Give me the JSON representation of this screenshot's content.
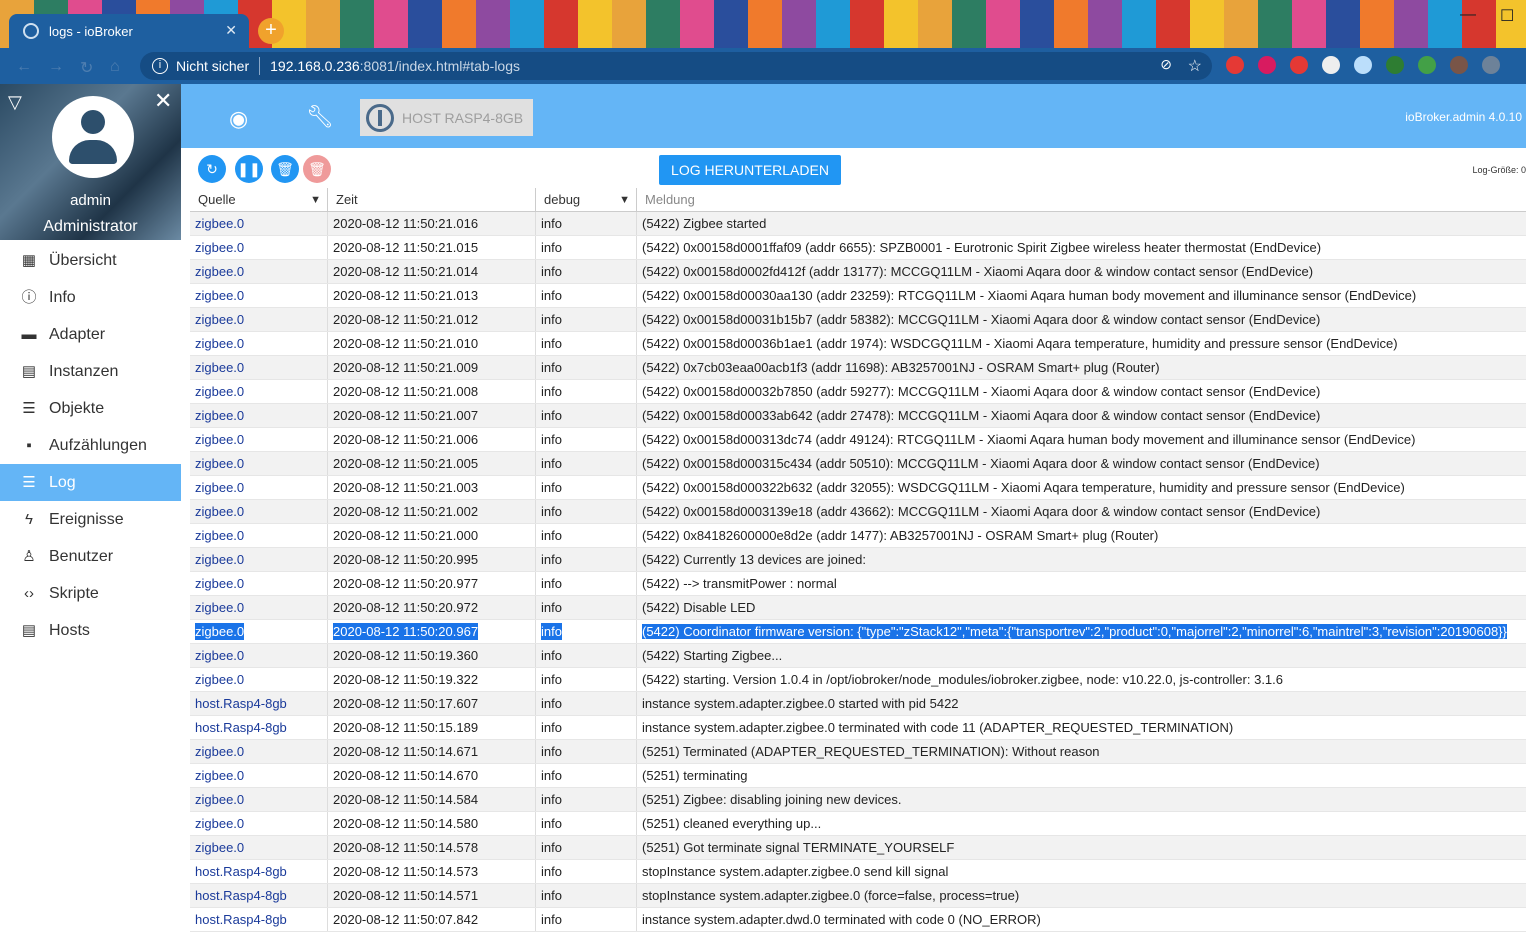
{
  "browser": {
    "tab_title": "logs - ioBroker",
    "new_tab": "+",
    "insecure_label": "Nicht sicher",
    "url_host": "192.168.0.236",
    "url_rest": ":8081/index.html#tab-logs"
  },
  "sidebar": {
    "user_name": "admin",
    "user_role": "Administrator",
    "items": [
      {
        "label": "Übersicht",
        "icon": "grid-icon"
      },
      {
        "label": "Info",
        "icon": "info-icon"
      },
      {
        "label": "Adapter",
        "icon": "store-icon"
      },
      {
        "label": "Instanzen",
        "icon": "instances-icon"
      },
      {
        "label": "Objekte",
        "icon": "list-icon"
      },
      {
        "label": "Aufzählungen",
        "icon": "enum-icon"
      },
      {
        "label": "Log",
        "icon": "log-icon"
      },
      {
        "label": "Ereignisse",
        "icon": "flash-icon"
      },
      {
        "label": "Benutzer",
        "icon": "user-icon"
      },
      {
        "label": "Skripte",
        "icon": "code-icon"
      },
      {
        "label": "Hosts",
        "icon": "hosts-icon"
      }
    ]
  },
  "appbar": {
    "host_label": "HOST RASP4-8GB",
    "version": "ioBroker.admin 4.0.10"
  },
  "toolbar": {
    "download_label": "LOG HERUNTERLADEN",
    "log_size_label": "Log-Größe: 0"
  },
  "table": {
    "headers": {
      "source": "Quelle",
      "time": "Zeit",
      "level": "debug",
      "message": "Meldung"
    },
    "rows": [
      {
        "source": "zigbee.0",
        "time": "2020-08-12 11:50:21.016",
        "level": "info",
        "message": "(5422) Zigbee started"
      },
      {
        "source": "zigbee.0",
        "time": "2020-08-12 11:50:21.015",
        "level": "info",
        "message": "(5422) 0x00158d0001ffaf09 (addr 6655): SPZB0001 - Eurotronic Spirit Zigbee wireless heater thermostat (EndDevice)"
      },
      {
        "source": "zigbee.0",
        "time": "2020-08-12 11:50:21.014",
        "level": "info",
        "message": "(5422) 0x00158d0002fd412f (addr 13177): MCCGQ11LM - Xiaomi Aqara door & window contact sensor (EndDevice)"
      },
      {
        "source": "zigbee.0",
        "time": "2020-08-12 11:50:21.013",
        "level": "info",
        "message": "(5422) 0x00158d00030aa130 (addr 23259): RTCGQ11LM - Xiaomi Aqara human body movement and illuminance sensor (EndDevice)"
      },
      {
        "source": "zigbee.0",
        "time": "2020-08-12 11:50:21.012",
        "level": "info",
        "message": "(5422) 0x00158d00031b15b7 (addr 58382): MCCGQ11LM - Xiaomi Aqara door & window contact sensor (EndDevice)"
      },
      {
        "source": "zigbee.0",
        "time": "2020-08-12 11:50:21.010",
        "level": "info",
        "message": "(5422) 0x00158d00036b1ae1 (addr 1974): WSDCGQ11LM - Xiaomi Aqara temperature, humidity and pressure sensor (EndDevice)"
      },
      {
        "source": "zigbee.0",
        "time": "2020-08-12 11:50:21.009",
        "level": "info",
        "message": "(5422) 0x7cb03eaa00acb1f3 (addr 11698): AB3257001NJ - OSRAM Smart+ plug (Router)"
      },
      {
        "source": "zigbee.0",
        "time": "2020-08-12 11:50:21.008",
        "level": "info",
        "message": "(5422) 0x00158d00032b7850 (addr 59277): MCCGQ11LM - Xiaomi Aqara door & window contact sensor (EndDevice)"
      },
      {
        "source": "zigbee.0",
        "time": "2020-08-12 11:50:21.007",
        "level": "info",
        "message": "(5422) 0x00158d00033ab642 (addr 27478): MCCGQ11LM - Xiaomi Aqara door & window contact sensor (EndDevice)"
      },
      {
        "source": "zigbee.0",
        "time": "2020-08-12 11:50:21.006",
        "level": "info",
        "message": "(5422) 0x00158d000313dc74 (addr 49124): RTCGQ11LM - Xiaomi Aqara human body movement and illuminance sensor (EndDevice)"
      },
      {
        "source": "zigbee.0",
        "time": "2020-08-12 11:50:21.005",
        "level": "info",
        "message": "(5422) 0x00158d000315c434 (addr 50510): MCCGQ11LM - Xiaomi Aqara door & window contact sensor (EndDevice)"
      },
      {
        "source": "zigbee.0",
        "time": "2020-08-12 11:50:21.003",
        "level": "info",
        "message": "(5422) 0x00158d000322b632 (addr 32055): WSDCGQ11LM - Xiaomi Aqara temperature, humidity and pressure sensor (EndDevice)"
      },
      {
        "source": "zigbee.0",
        "time": "2020-08-12 11:50:21.002",
        "level": "info",
        "message": "(5422) 0x00158d0003139e18 (addr 43662): MCCGQ11LM - Xiaomi Aqara door & window contact sensor (EndDevice)"
      },
      {
        "source": "zigbee.0",
        "time": "2020-08-12 11:50:21.000",
        "level": "info",
        "message": "(5422) 0x84182600000e8d2e (addr 1477): AB3257001NJ - OSRAM Smart+ plug (Router)"
      },
      {
        "source": "zigbee.0",
        "time": "2020-08-12 11:50:20.995",
        "level": "info",
        "message": "(5422) Currently 13 devices are joined:"
      },
      {
        "source": "zigbee.0",
        "time": "2020-08-12 11:50:20.977",
        "level": "info",
        "message": "(5422) --> transmitPower : normal"
      },
      {
        "source": "zigbee.0",
        "time": "2020-08-12 11:50:20.972",
        "level": "info",
        "message": "(5422) Disable LED"
      },
      {
        "source": "zigbee.0",
        "time": "2020-08-12 11:50:20.967",
        "level": "info",
        "message": "(5422) Coordinator firmware version: {\"type\":\"zStack12\",\"meta\":{\"transportrev\":2,\"product\":0,\"majorrel\":2,\"minorrel\":6,\"maintrel\":3,\"revision\":20190608}}",
        "selected": true
      },
      {
        "source": "zigbee.0",
        "time": "2020-08-12 11:50:19.360",
        "level": "info",
        "message": "(5422) Starting Zigbee..."
      },
      {
        "source": "zigbee.0",
        "time": "2020-08-12 11:50:19.322",
        "level": "info",
        "message": "(5422) starting. Version 1.0.4 in /opt/iobroker/node_modules/iobroker.zigbee, node: v10.22.0, js-controller: 3.1.6"
      },
      {
        "source": "host.Rasp4-8gb",
        "time": "2020-08-12 11:50:17.607",
        "level": "info",
        "message": "instance system.adapter.zigbee.0 started with pid 5422"
      },
      {
        "source": "host.Rasp4-8gb",
        "time": "2020-08-12 11:50:15.189",
        "level": "info",
        "message": "instance system.adapter.zigbee.0 terminated with code 11 (ADAPTER_REQUESTED_TERMINATION)"
      },
      {
        "source": "zigbee.0",
        "time": "2020-08-12 11:50:14.671",
        "level": "info",
        "message": "(5251) Terminated (ADAPTER_REQUESTED_TERMINATION): Without reason"
      },
      {
        "source": "zigbee.0",
        "time": "2020-08-12 11:50:14.670",
        "level": "info",
        "message": "(5251) terminating"
      },
      {
        "source": "zigbee.0",
        "time": "2020-08-12 11:50:14.584",
        "level": "info",
        "message": "(5251) Zigbee: disabling joining new devices."
      },
      {
        "source": "zigbee.0",
        "time": "2020-08-12 11:50:14.580",
        "level": "info",
        "message": "(5251) cleaned everything up..."
      },
      {
        "source": "zigbee.0",
        "time": "2020-08-12 11:50:14.578",
        "level": "info",
        "message": "(5251) Got terminate signal TERMINATE_YOURSELF"
      },
      {
        "source": "host.Rasp4-8gb",
        "time": "2020-08-12 11:50:14.573",
        "level": "info",
        "message": "stopInstance system.adapter.zigbee.0 send kill signal"
      },
      {
        "source": "host.Rasp4-8gb",
        "time": "2020-08-12 11:50:14.571",
        "level": "info",
        "message": "stopInstance system.adapter.zigbee.0 (force=false, process=true)"
      },
      {
        "source": "host.Rasp4-8gb",
        "time": "2020-08-12 11:50:07.842",
        "level": "info",
        "message": "instance system.adapter.dwd.0 terminated with code 0 (NO_ERROR)"
      }
    ]
  }
}
